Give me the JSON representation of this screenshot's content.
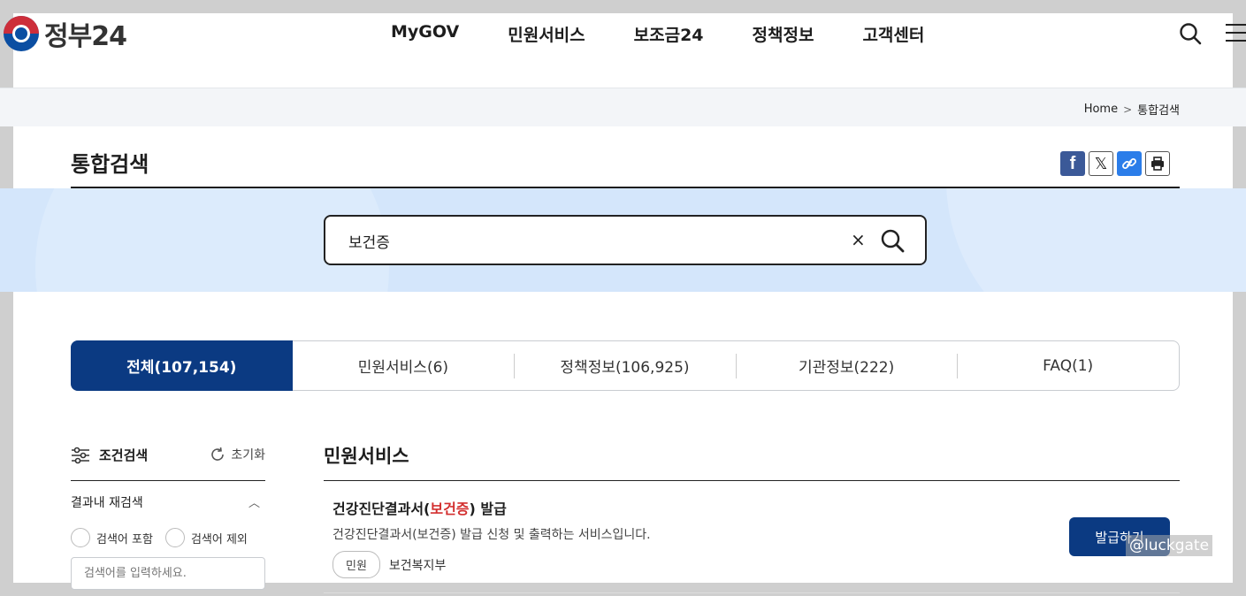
{
  "header": {
    "logo_text": "정부24",
    "nav": [
      "MyGOV",
      "민원서비스",
      "보조금24",
      "정책정보",
      "고객센터"
    ]
  },
  "breadcrumb": {
    "home": "Home",
    "current": "통합검색"
  },
  "page": {
    "title": "통합검색"
  },
  "search": {
    "value": "보건증",
    "clear_symbol": "×"
  },
  "tabs": [
    {
      "label": "전체(107,154)",
      "active": true
    },
    {
      "label": "민원서비스(6)",
      "active": false
    },
    {
      "label": "정책정보(106,925)",
      "active": false
    },
    {
      "label": "기관정보(222)",
      "active": false
    },
    {
      "label": "FAQ(1)",
      "active": false
    }
  ],
  "filter": {
    "title": "조건검색",
    "reset": "초기화",
    "refine_label": "결과내 재검색",
    "include": "검색어 포함",
    "exclude": "검색어 제외",
    "placeholder": "검색어를 입력하세요."
  },
  "results": {
    "section_title": "민원서비스",
    "item": {
      "name_before": "건강진단결과서(",
      "name_highlight": "보건증",
      "name_after": ") 발급",
      "description": "건강진단결과서(보건증) 발급 신청 및 출력하는 서비스입니다.",
      "badge": "민원",
      "agency": "보건복지부",
      "button": "발급하기"
    }
  },
  "watermark": "@luckgate",
  "colors": {
    "primary": "#0b3a82",
    "highlight": "#d32f2f",
    "band": "#d4e6fb"
  }
}
